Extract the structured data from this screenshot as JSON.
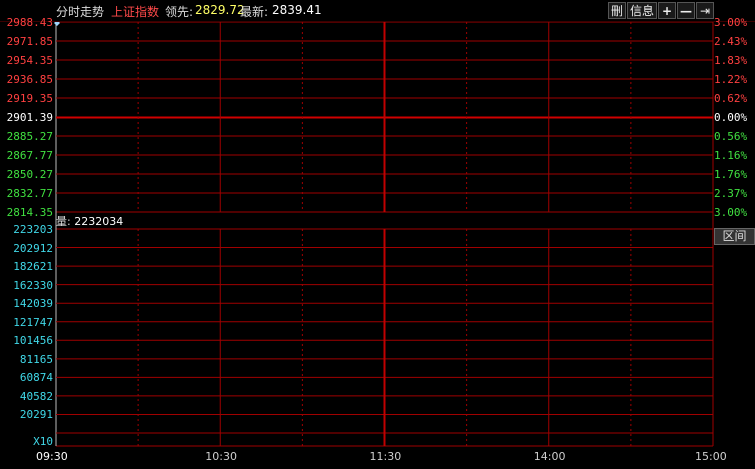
{
  "header": {
    "title": "分时走势",
    "index_name": "上证指数",
    "lead_label": "领先:",
    "lead_value": "2829.72",
    "latest_label": "最新:",
    "latest_value": "2839.41",
    "buttons": [
      "刪",
      "信息",
      "+",
      "—",
      "⇥"
    ]
  },
  "price_axis": {
    "left_labels": [
      "2988.43",
      "2971.85",
      "2954.35",
      "2936.85",
      "2919.35",
      "2901.39",
      "2885.27",
      "2867.77",
      "2850.27",
      "2832.77",
      "2814.35"
    ],
    "right_labels": [
      "3.00%",
      "2.43%",
      "1.83%",
      "1.22%",
      "0.62%",
      "0.00%",
      "0.56%",
      "1.16%",
      "1.76%",
      "2.37%",
      "3.00%"
    ],
    "colors": {
      "up": "#ff4040",
      "base": "#ffffff",
      "down": "#40e040"
    }
  },
  "volume": {
    "label": "量:",
    "value": "2232034",
    "axis_labels": [
      "223203",
      "202912",
      "182621",
      "162330",
      "142039",
      "121747",
      "101456",
      "81165",
      "60874",
      "40582",
      "20291"
    ],
    "multiplier": "X10",
    "label_color": "#40d8e8"
  },
  "interval_button": "区间",
  "time_axis": [
    "09:30",
    "10:30",
    "11:30",
    "14:00",
    "15:00"
  ],
  "grid_color": "#a00000"
}
